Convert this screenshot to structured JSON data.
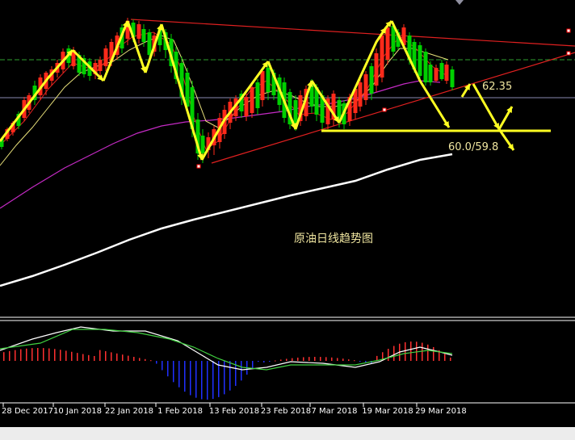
{
  "chart_data": {
    "type": "candlestick",
    "title": "原油日线趋势图",
    "x_ticks": [
      "28 Dec 2017",
      "10 Jan 2018",
      "22 Jan 2018",
      "1 Feb 2018",
      "13 Feb 2018",
      "23 Feb 2018",
      "7 Mar 2018",
      "19 Mar 2018",
      "29 Mar 2018"
    ],
    "annotations": {
      "resistance": "62.35",
      "support": "60.0/59.8"
    },
    "grid": false,
    "background": "#000000",
    "colors": {
      "up": "#ff2a1a",
      "down": "#00d000",
      "trend_arrows": "#ffff22",
      "prediction_arrows": "#ffff22",
      "resistance_line": "#e02020",
      "support_line": "#ffff22",
      "ema_fast": "#e8e07a",
      "ema_mid": "#c42ac4",
      "ema_slow": "#ffffff",
      "macd_line": "#ffffff",
      "signal_line": "#40d040",
      "hist_pos": "#ff3030",
      "hist_neg": "#2030ff",
      "dashed_level": "#30a030"
    },
    "indicators": [
      "price",
      "moving_averages",
      "macd"
    ]
  }
}
